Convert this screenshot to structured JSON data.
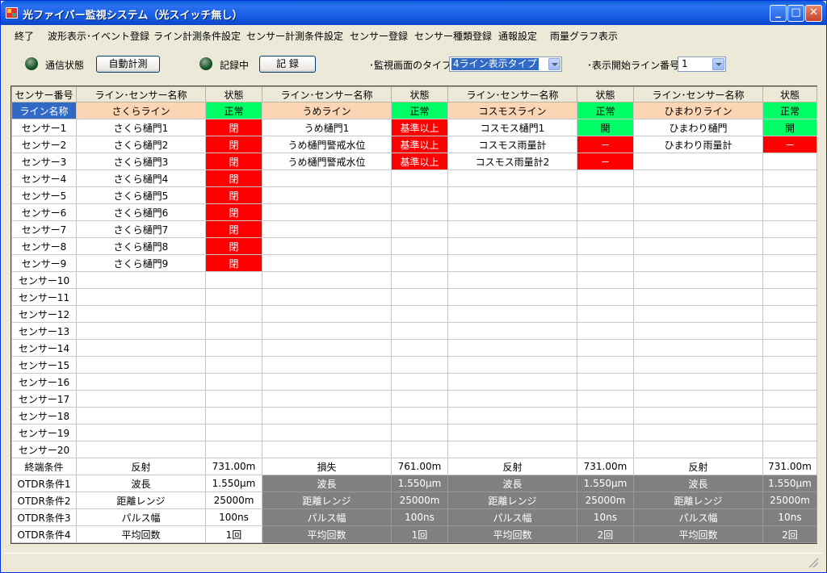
{
  "window": {
    "title": "光ファイバー監視システム（光スイッチ無し）"
  },
  "menu": [
    "終了",
    "波形表示･イベント登録",
    "ライン計測条件設定",
    "センサー計測条件設定",
    "センサー登録",
    "センサー種類登録",
    "通報設定",
    "雨量グラフ表示"
  ],
  "toolbar": {
    "comm_label": "通信状態",
    "auto_button": "自動計測",
    "record_status": "記録中",
    "record_button": "記 録",
    "screen_type_label": "･監視画面のタイプ",
    "screen_type_value": "4ライン表示タイプ",
    "start_line_label": "･表示開始ライン番号",
    "start_line_value": "1"
  },
  "colors": {
    "ok": "#00ff66",
    "alarm": "#ff0000",
    "line_name_bg": "#fcd5b4",
    "selected": "#316ac5",
    "otdr_gray": "#808080"
  },
  "grid": {
    "headers": [
      "センサー番号",
      "ライン･センサー名称",
      "状態",
      "ライン･センサー名称",
      "状態",
      "ライン･センサー名称",
      "状態",
      "ライン･センサー名称",
      "状態"
    ],
    "line_row": {
      "label": "ライン名称",
      "cells": [
        {
          "name": "さくらライン",
          "status": "正常",
          "st": "ok"
        },
        {
          "name": "うめライン",
          "status": "正常",
          "st": "ok"
        },
        {
          "name": "コスモスライン",
          "status": "正常",
          "st": "ok"
        },
        {
          "name": "ひまわりライン",
          "status": "正常",
          "st": "ok"
        }
      ]
    },
    "sensor_rows": [
      {
        "label": "センサー1",
        "cells": [
          {
            "name": "さくら樋門1",
            "status": "閉",
            "st": "bad"
          },
          {
            "name": "うめ樋門1",
            "status": "基準以上",
            "st": "bad"
          },
          {
            "name": "コスモス樋門1",
            "status": "開",
            "st": "ok"
          },
          {
            "name": "ひまわり樋門",
            "status": "開",
            "st": "ok"
          }
        ]
      },
      {
        "label": "センサー2",
        "cells": [
          {
            "name": "さくら樋門2",
            "status": "閉",
            "st": "bad"
          },
          {
            "name": "うめ樋門警戒水位",
            "status": "基準以上",
            "st": "bad"
          },
          {
            "name": "コスモス雨量計",
            "status": "－",
            "st": "bad"
          },
          {
            "name": "ひまわり雨量計",
            "status": "－",
            "st": "bad"
          }
        ]
      },
      {
        "label": "センサー3",
        "cells": [
          {
            "name": "さくら樋門3",
            "status": "閉",
            "st": "bad"
          },
          {
            "name": "うめ樋門警戒水位",
            "status": "基準以上",
            "st": "bad"
          },
          {
            "name": "コスモス雨量計2",
            "status": "－",
            "st": "bad"
          },
          {
            "name": "",
            "status": "",
            "st": ""
          }
        ]
      },
      {
        "label": "センサー4",
        "cells": [
          {
            "name": "さくら樋門4",
            "status": "閉",
            "st": "bad"
          },
          {
            "name": "",
            "status": "",
            "st": ""
          },
          {
            "name": "",
            "status": "",
            "st": ""
          },
          {
            "name": "",
            "status": "",
            "st": ""
          }
        ]
      },
      {
        "label": "センサー5",
        "cells": [
          {
            "name": "さくら樋門5",
            "status": "閉",
            "st": "bad"
          },
          {
            "name": "",
            "status": "",
            "st": ""
          },
          {
            "name": "",
            "status": "",
            "st": ""
          },
          {
            "name": "",
            "status": "",
            "st": ""
          }
        ]
      },
      {
        "label": "センサー6",
        "cells": [
          {
            "name": "さくら樋門6",
            "status": "閉",
            "st": "bad"
          },
          {
            "name": "",
            "status": "",
            "st": ""
          },
          {
            "name": "",
            "status": "",
            "st": ""
          },
          {
            "name": "",
            "status": "",
            "st": ""
          }
        ]
      },
      {
        "label": "センサー7",
        "cells": [
          {
            "name": "さくら樋門7",
            "status": "閉",
            "st": "bad"
          },
          {
            "name": "",
            "status": "",
            "st": ""
          },
          {
            "name": "",
            "status": "",
            "st": ""
          },
          {
            "name": "",
            "status": "",
            "st": ""
          }
        ]
      },
      {
        "label": "センサー8",
        "cells": [
          {
            "name": "さくら樋門8",
            "status": "閉",
            "st": "bad"
          },
          {
            "name": "",
            "status": "",
            "st": ""
          },
          {
            "name": "",
            "status": "",
            "st": ""
          },
          {
            "name": "",
            "status": "",
            "st": ""
          }
        ]
      },
      {
        "label": "センサー9",
        "cells": [
          {
            "name": "さくら樋門9",
            "status": "閉",
            "st": "bad"
          },
          {
            "name": "",
            "status": "",
            "st": ""
          },
          {
            "name": "",
            "status": "",
            "st": ""
          },
          {
            "name": "",
            "status": "",
            "st": ""
          }
        ]
      },
      {
        "label": "センサー10",
        "cells": []
      },
      {
        "label": "センサー11",
        "cells": []
      },
      {
        "label": "センサー12",
        "cells": []
      },
      {
        "label": "センサー13",
        "cells": []
      },
      {
        "label": "センサー14",
        "cells": []
      },
      {
        "label": "センサー15",
        "cells": []
      },
      {
        "label": "センサー16",
        "cells": []
      },
      {
        "label": "センサー17",
        "cells": []
      },
      {
        "label": "センサー18",
        "cells": []
      },
      {
        "label": "センサー19",
        "cells": []
      },
      {
        "label": "センサー20",
        "cells": []
      }
    ],
    "termination_row": {
      "label": "終端条件",
      "cells": [
        {
          "name": "反射",
          "value": "731.00m"
        },
        {
          "name": "損失",
          "value": "761.00m"
        },
        {
          "name": "反射",
          "value": "731.00m"
        },
        {
          "name": "反射",
          "value": "731.00m"
        }
      ]
    },
    "otdr_rows": [
      {
        "label": "OTDR条件1",
        "cells": [
          {
            "name": "波長",
            "value": "1.550μm"
          },
          {
            "name": "波長",
            "value": "1.550μm"
          },
          {
            "name": "波長",
            "value": "1.550μm"
          },
          {
            "name": "波長",
            "value": "1.550μm"
          }
        ]
      },
      {
        "label": "OTDR条件2",
        "cells": [
          {
            "name": "距離レンジ",
            "value": "25000m"
          },
          {
            "name": "距離レンジ",
            "value": "25000m"
          },
          {
            "name": "距離レンジ",
            "value": "25000m"
          },
          {
            "name": "距離レンジ",
            "value": "25000m"
          }
        ]
      },
      {
        "label": "OTDR条件3",
        "cells": [
          {
            "name": "パルス幅",
            "value": "100ns"
          },
          {
            "name": "パルス幅",
            "value": "100ns"
          },
          {
            "name": "パルス幅",
            "value": "10ns"
          },
          {
            "name": "パルス幅",
            "value": "10ns"
          }
        ]
      },
      {
        "label": "OTDR条件4",
        "cells": [
          {
            "name": "平均回数",
            "value": "1回"
          },
          {
            "name": "平均回数",
            "value": "1回"
          },
          {
            "name": "平均回数",
            "value": "2回"
          },
          {
            "name": "平均回数",
            "value": "2回"
          }
        ]
      }
    ]
  }
}
